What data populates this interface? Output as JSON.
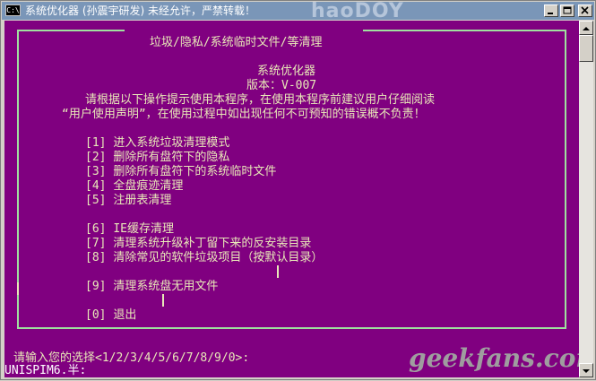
{
  "window": {
    "title": "系统优化器 (孙震宇研发) 未经允许，严禁转载！",
    "app_icon_label": "C:\\",
    "watermark_top": "haoDOY",
    "watermark_bottom": "geekfans.com"
  },
  "header": {
    "heading": "垃圾/隐私/系统临时文件/等清理",
    "app_name": "系统优化器",
    "version": "版本：V-007",
    "notice_line1": "请根据以下操作提示使用本程序，在使用本程序前建议用户仔细阅读",
    "notice_line2": "“用户使用声明”，在使用过程中如出现任何不可预知的错误概不负责！"
  },
  "menu": [
    {
      "key": "[1]",
      "label": "进入系统垃圾清理模式"
    },
    {
      "key": "[2]",
      "label": "删除所有盘符下的隐私"
    },
    {
      "key": "[3]",
      "label": "删除所有盘符下的系统临时文件"
    },
    {
      "key": "[4]",
      "label": "全盘痕迹清理"
    },
    {
      "key": "[5]",
      "label": "注册表清理"
    },
    {
      "key": "[6]",
      "label": "IE缓存清理"
    },
    {
      "key": "[7]",
      "label": "清理系统升级补丁留下来的反安装目录"
    },
    {
      "key": "[8]",
      "label": "清除常见的软件垃圾项目（按默认目录）"
    },
    {
      "key": "[9]",
      "label": "清理系统盘无用文件"
    },
    {
      "key": "[0]",
      "label": "退出"
    }
  ],
  "prompt": {
    "text": "请输入您的选择<1/2/3/4/5/6/7/8/9/0>:",
    "next_line": "UNISPIM6.半:"
  },
  "colors": {
    "console_bg": "#800080",
    "text": "#e8e8b8",
    "frame": "#9fe09f",
    "titlebar": "#7a96b8"
  }
}
